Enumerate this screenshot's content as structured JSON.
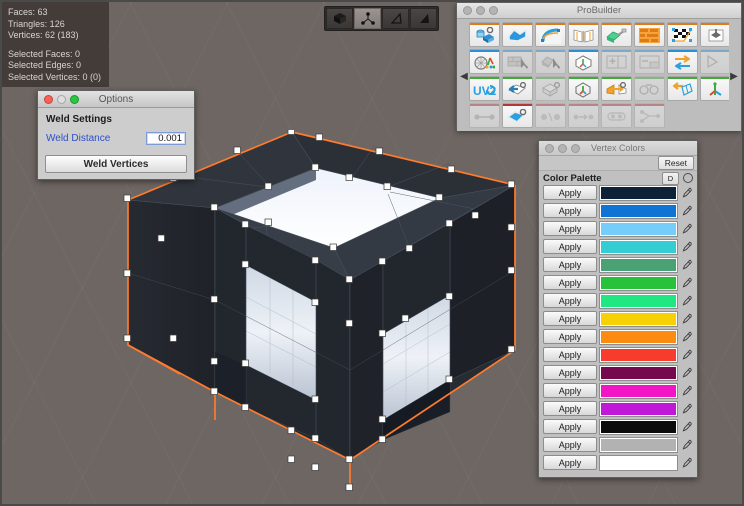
{
  "app": {
    "background_color": "#6e6662"
  },
  "scene_stats": {
    "faces": "Faces: 63",
    "triangles": "Triangles: 126",
    "vertices": "Vertices: 62 (183)",
    "selected_faces": "Selected Faces: 0",
    "selected_edges": "Selected Edges: 0",
    "selected_vertices": "Selected Vertices: 0 (0)"
  },
  "element_mode_toolbar": {
    "modes": [
      {
        "name": "object-mode",
        "icon": "cube-icon",
        "selected": false
      },
      {
        "name": "vertex-mode",
        "icon": "vertex-icon",
        "selected": true
      },
      {
        "name": "edge-mode",
        "icon": "edge-icon",
        "selected": false
      },
      {
        "name": "face-mode",
        "icon": "face-icon",
        "selected": false
      }
    ]
  },
  "options_window": {
    "title": "Options",
    "section_heading": "Weld Settings",
    "weld_distance_label": "Weld Distance",
    "weld_distance_value": "0.001",
    "weld_button_label": "Weld Vertices"
  },
  "probuilder_window": {
    "title": "ProBuilder",
    "left_arrow": "◀",
    "right_arrow": "▶",
    "rows": [
      {
        "accent": "#d87c1e",
        "tools": [
          {
            "name": "new-shape-tool",
            "icon": "shape-cube-gear-icon",
            "dim": false
          },
          {
            "name": "new-poly-shape-tool",
            "icon": "poly-shape-icon",
            "dim": false
          },
          {
            "name": "new-bezier-shape-tool",
            "icon": "bezier-shape-icon",
            "dim": false
          },
          {
            "name": "probuilderize-tool",
            "icon": "book-page-icon",
            "dim": false
          },
          {
            "name": "material-editor-tool",
            "icon": "paint-roller-icon",
            "dim": false
          },
          {
            "name": "smoothing-groups-tool",
            "icon": "brick-wall-icon",
            "dim": false
          },
          {
            "name": "uv-editor-tool",
            "icon": "checker-uv-icon",
            "dim": false
          },
          {
            "name": "vertex-colors-tool",
            "icon": "paint-bucket-icon",
            "dim": false
          }
        ]
      },
      {
        "accent": "#2b8fd8",
        "tools": [
          {
            "name": "vertex-colors-panel-tool",
            "icon": "color-wheel-icon",
            "dim": false
          },
          {
            "name": "select-by-material-tool",
            "icon": "material-cursor-icon",
            "dim": true
          },
          {
            "name": "select-by-color-tool",
            "icon": "shape-cursor-icon",
            "dim": true
          },
          {
            "name": "select-hole-tool",
            "icon": "hole-select-icon",
            "dim": false
          },
          {
            "name": "grow-selection-tool",
            "icon": "plus-box-icon",
            "dim": true
          },
          {
            "name": "shrink-selection-tool",
            "icon": "minus-box-icon",
            "dim": true
          },
          {
            "name": "invert-selection-tool",
            "icon": "swap-arrows-icon",
            "dim": false
          },
          {
            "name": "select-loop-tool",
            "icon": "lasso-icon",
            "dim": true
          }
        ]
      },
      {
        "accent": "#3faa35",
        "tools": [
          {
            "name": "uv2-tool",
            "icon": "uv2-icon",
            "dim": false
          },
          {
            "name": "flip-normals-tool",
            "icon": "flip-normals-icon",
            "dim": false
          },
          {
            "name": "conform-normals-tool",
            "icon": "conform-normals-icon",
            "dim": true
          },
          {
            "name": "center-pivot-tool",
            "icon": "center-pivot-icon",
            "dim": false
          },
          {
            "name": "mirror-objects-tool",
            "icon": "mirror-objects-icon",
            "dim": false
          },
          {
            "name": "merge-objects-tool",
            "icon": "merge-objects-icon",
            "dim": true
          },
          {
            "name": "subdivide-object-tool",
            "icon": "subdivide-object-icon",
            "dim": false
          },
          {
            "name": "freeze-transform-tool",
            "icon": "axis-gizmo-icon",
            "dim": false
          }
        ]
      },
      {
        "accent": "#b03a3a",
        "tools": [
          {
            "name": "connect-vertices-tool",
            "icon": "connect-vertices-icon",
            "dim": true
          },
          {
            "name": "weld-vertices-tool",
            "icon": "weld-vertices-icon",
            "dim": false
          },
          {
            "name": "split-vertices-tool",
            "icon": "split-vertices-icon",
            "dim": true
          },
          {
            "name": "collapse-vertices-tool",
            "icon": "collapse-vertices-icon",
            "dim": true
          },
          {
            "name": "fill-hole-tool",
            "icon": "fill-hole-icon",
            "dim": true
          },
          {
            "name": "subdivide-edges-tool",
            "icon": "subdivide-edges-icon",
            "dim": true
          }
        ]
      }
    ]
  },
  "vertex_colors_window": {
    "title": "Vertex Colors",
    "reset_label": "Reset",
    "palette_label": "Color Palette",
    "dropdown_label": "D",
    "apply_label": "Apply",
    "swatches": [
      {
        "name": "swatch-navy",
        "color": "#0d2238"
      },
      {
        "name": "swatch-blue",
        "color": "#0f74d4"
      },
      {
        "name": "swatch-light-blue",
        "color": "#76cdf9"
      },
      {
        "name": "swatch-cyan",
        "color": "#34cdd4"
      },
      {
        "name": "swatch-sea-green",
        "color": "#4aa274"
      },
      {
        "name": "swatch-green",
        "color": "#27c23a"
      },
      {
        "name": "swatch-spring-green",
        "color": "#1fe882"
      },
      {
        "name": "swatch-yellow",
        "color": "#f7d006"
      },
      {
        "name": "swatch-orange",
        "color": "#fb8c11"
      },
      {
        "name": "swatch-red",
        "color": "#f73c2e"
      },
      {
        "name": "swatch-maroon",
        "color": "#76094d"
      },
      {
        "name": "swatch-magenta",
        "color": "#f215c6"
      },
      {
        "name": "swatch-purple",
        "color": "#c017d8"
      },
      {
        "name": "swatch-black",
        "color": "#0b0b0b"
      },
      {
        "name": "swatch-gray",
        "color": "#b2b2b2"
      },
      {
        "name": "swatch-white",
        "color": "#ffffff"
      }
    ]
  },
  "model": {
    "name": "hollow-box-mesh",
    "selection_outline_color": "#ff7b2e",
    "vertex_handle_color": "#ffffff",
    "mesh_dark_color": "#2a2e35",
    "mesh_face_color": "#c9d2de"
  }
}
